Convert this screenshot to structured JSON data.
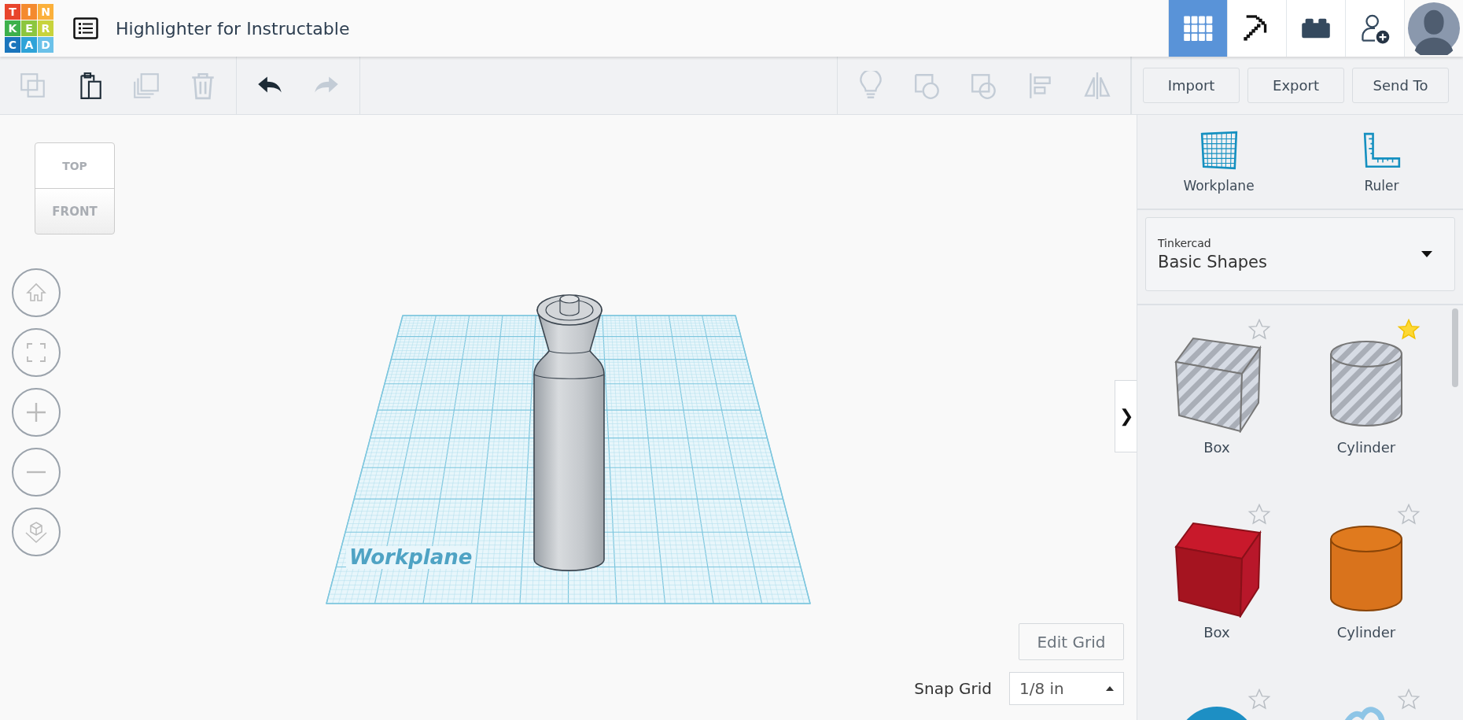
{
  "logo": {
    "letters": [
      "T",
      "I",
      "N",
      "K",
      "E",
      "R",
      "C",
      "A",
      "D"
    ]
  },
  "design_title": "Highlighter for Instructable",
  "nav": [
    {
      "kind": "grid",
      "selected": true
    },
    {
      "kind": "pickaxe",
      "selected": false
    },
    {
      "kind": "brick",
      "selected": false
    },
    {
      "kind": "add-user",
      "selected": false
    }
  ],
  "toolbar": {
    "left": [
      {
        "kind": "copy",
        "disabled": true
      },
      {
        "kind": "paste",
        "disabled": false
      },
      {
        "kind": "duplicate",
        "disabled": true
      },
      {
        "kind": "delete",
        "disabled": true
      },
      {
        "kind": "undo",
        "disabled": false
      },
      {
        "kind": "redo",
        "disabled": true
      }
    ],
    "right": [
      {
        "kind": "bulb",
        "disabled": true
      },
      {
        "kind": "group",
        "disabled": true
      },
      {
        "kind": "ungroup",
        "disabled": true
      },
      {
        "kind": "align",
        "disabled": true
      },
      {
        "kind": "mirror",
        "disabled": true
      }
    ],
    "buttons": [
      "Import",
      "Export",
      "Send To"
    ]
  },
  "view_cube": {
    "top": "TOP",
    "front": "FRONT"
  },
  "view_controls": [
    {
      "kind": "home"
    },
    {
      "kind": "fit"
    },
    {
      "kind": "zoom-in"
    },
    {
      "kind": "zoom-out"
    },
    {
      "kind": "ortho"
    }
  ],
  "workplane_label": "Workplane",
  "collapse_toggle": "❯",
  "edit_grid": "Edit Grid",
  "snap_grid": {
    "label": "Snap Grid",
    "value": "1/8 in"
  },
  "panel": {
    "tools": [
      {
        "kind": "workplane",
        "label": "Workplane"
      },
      {
        "kind": "ruler",
        "label": "Ruler"
      }
    ],
    "library": {
      "source": "Tinkercad",
      "name": "Basic Shapes"
    },
    "shapes": [
      {
        "kind": "box",
        "hole": true,
        "favorite": false,
        "label": "Box"
      },
      {
        "kind": "cylinder",
        "hole": true,
        "favorite": true,
        "label": "Cylinder"
      },
      {
        "kind": "box",
        "hole": false,
        "favorite": false,
        "label": "Box"
      },
      {
        "kind": "cylinder",
        "hole": false,
        "favorite": false,
        "label": "Cylinder"
      },
      {
        "kind": "sphere",
        "favorite": false
      },
      {
        "kind": "scribble",
        "favorite": false
      }
    ]
  }
}
